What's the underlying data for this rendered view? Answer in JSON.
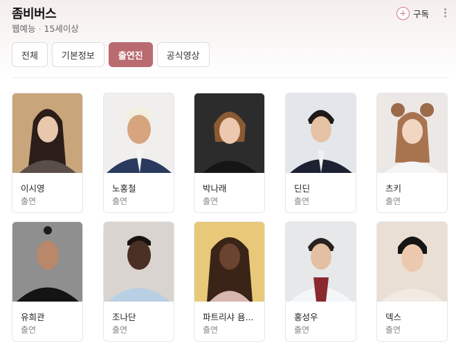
{
  "program": {
    "title": "좀비버스",
    "genre": "웹예능",
    "rating": "15세이상"
  },
  "subscribe": {
    "label": "구독",
    "icon": "plus-circle-icon"
  },
  "tabs": [
    {
      "label": "전체",
      "active": false
    },
    {
      "label": "기본정보",
      "active": false
    },
    {
      "label": "출연진",
      "active": true
    },
    {
      "label": "공식영상",
      "active": false
    }
  ],
  "colors": {
    "accent": "#b96b70",
    "header_bg": "#f5eeee"
  },
  "cast": [
    {
      "name": "이시영",
      "role": "출연"
    },
    {
      "name": "노홍철",
      "role": "출연"
    },
    {
      "name": "박나래",
      "role": "출연"
    },
    {
      "name": "딘딘",
      "role": "출연"
    },
    {
      "name": "츠키",
      "role": "출연"
    },
    {
      "name": "유희관",
      "role": "출연"
    },
    {
      "name": "조나단",
      "role": "출연"
    },
    {
      "name": "파트리샤 욤...",
      "role": "출연"
    },
    {
      "name": "홍성우",
      "role": "출연"
    },
    {
      "name": "덱스",
      "role": "출연"
    }
  ]
}
